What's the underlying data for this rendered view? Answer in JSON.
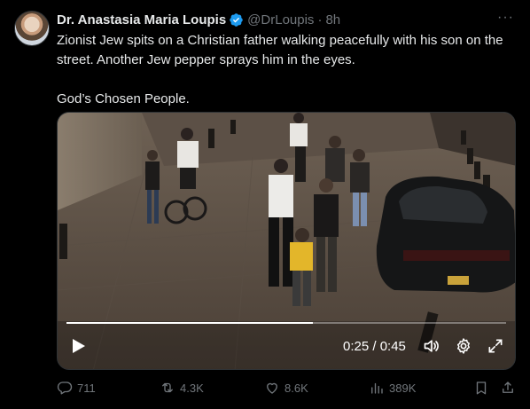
{
  "author": {
    "display_name": "Dr. Anastasia Maria Loupis",
    "handle": "@DrLoupis",
    "separator": "·",
    "time": "8h",
    "verified_icon": "verified-badge-icon",
    "avatar_icon": "profile-avatar"
  },
  "more_label": "···",
  "tweet": {
    "line1": "Zionist Jew spits on a Christian father walking peacefully with his son on the street. Another Jew pepper sprays him in the eyes.",
    "line2": "God’s Chosen People."
  },
  "video": {
    "time_display": "0:25 / 0:45",
    "progress": 0.56,
    "icons": [
      "play-icon",
      "volume-icon",
      "settings-icon",
      "fullscreen-icon"
    ]
  },
  "actions": {
    "replies": "711",
    "reposts": "4.3K",
    "likes": "8.6K",
    "views": "389K"
  },
  "colors": {
    "background": "#000000",
    "text": "#e7e9ea",
    "muted": "#71767b",
    "verified": "#1d9bf0"
  }
}
